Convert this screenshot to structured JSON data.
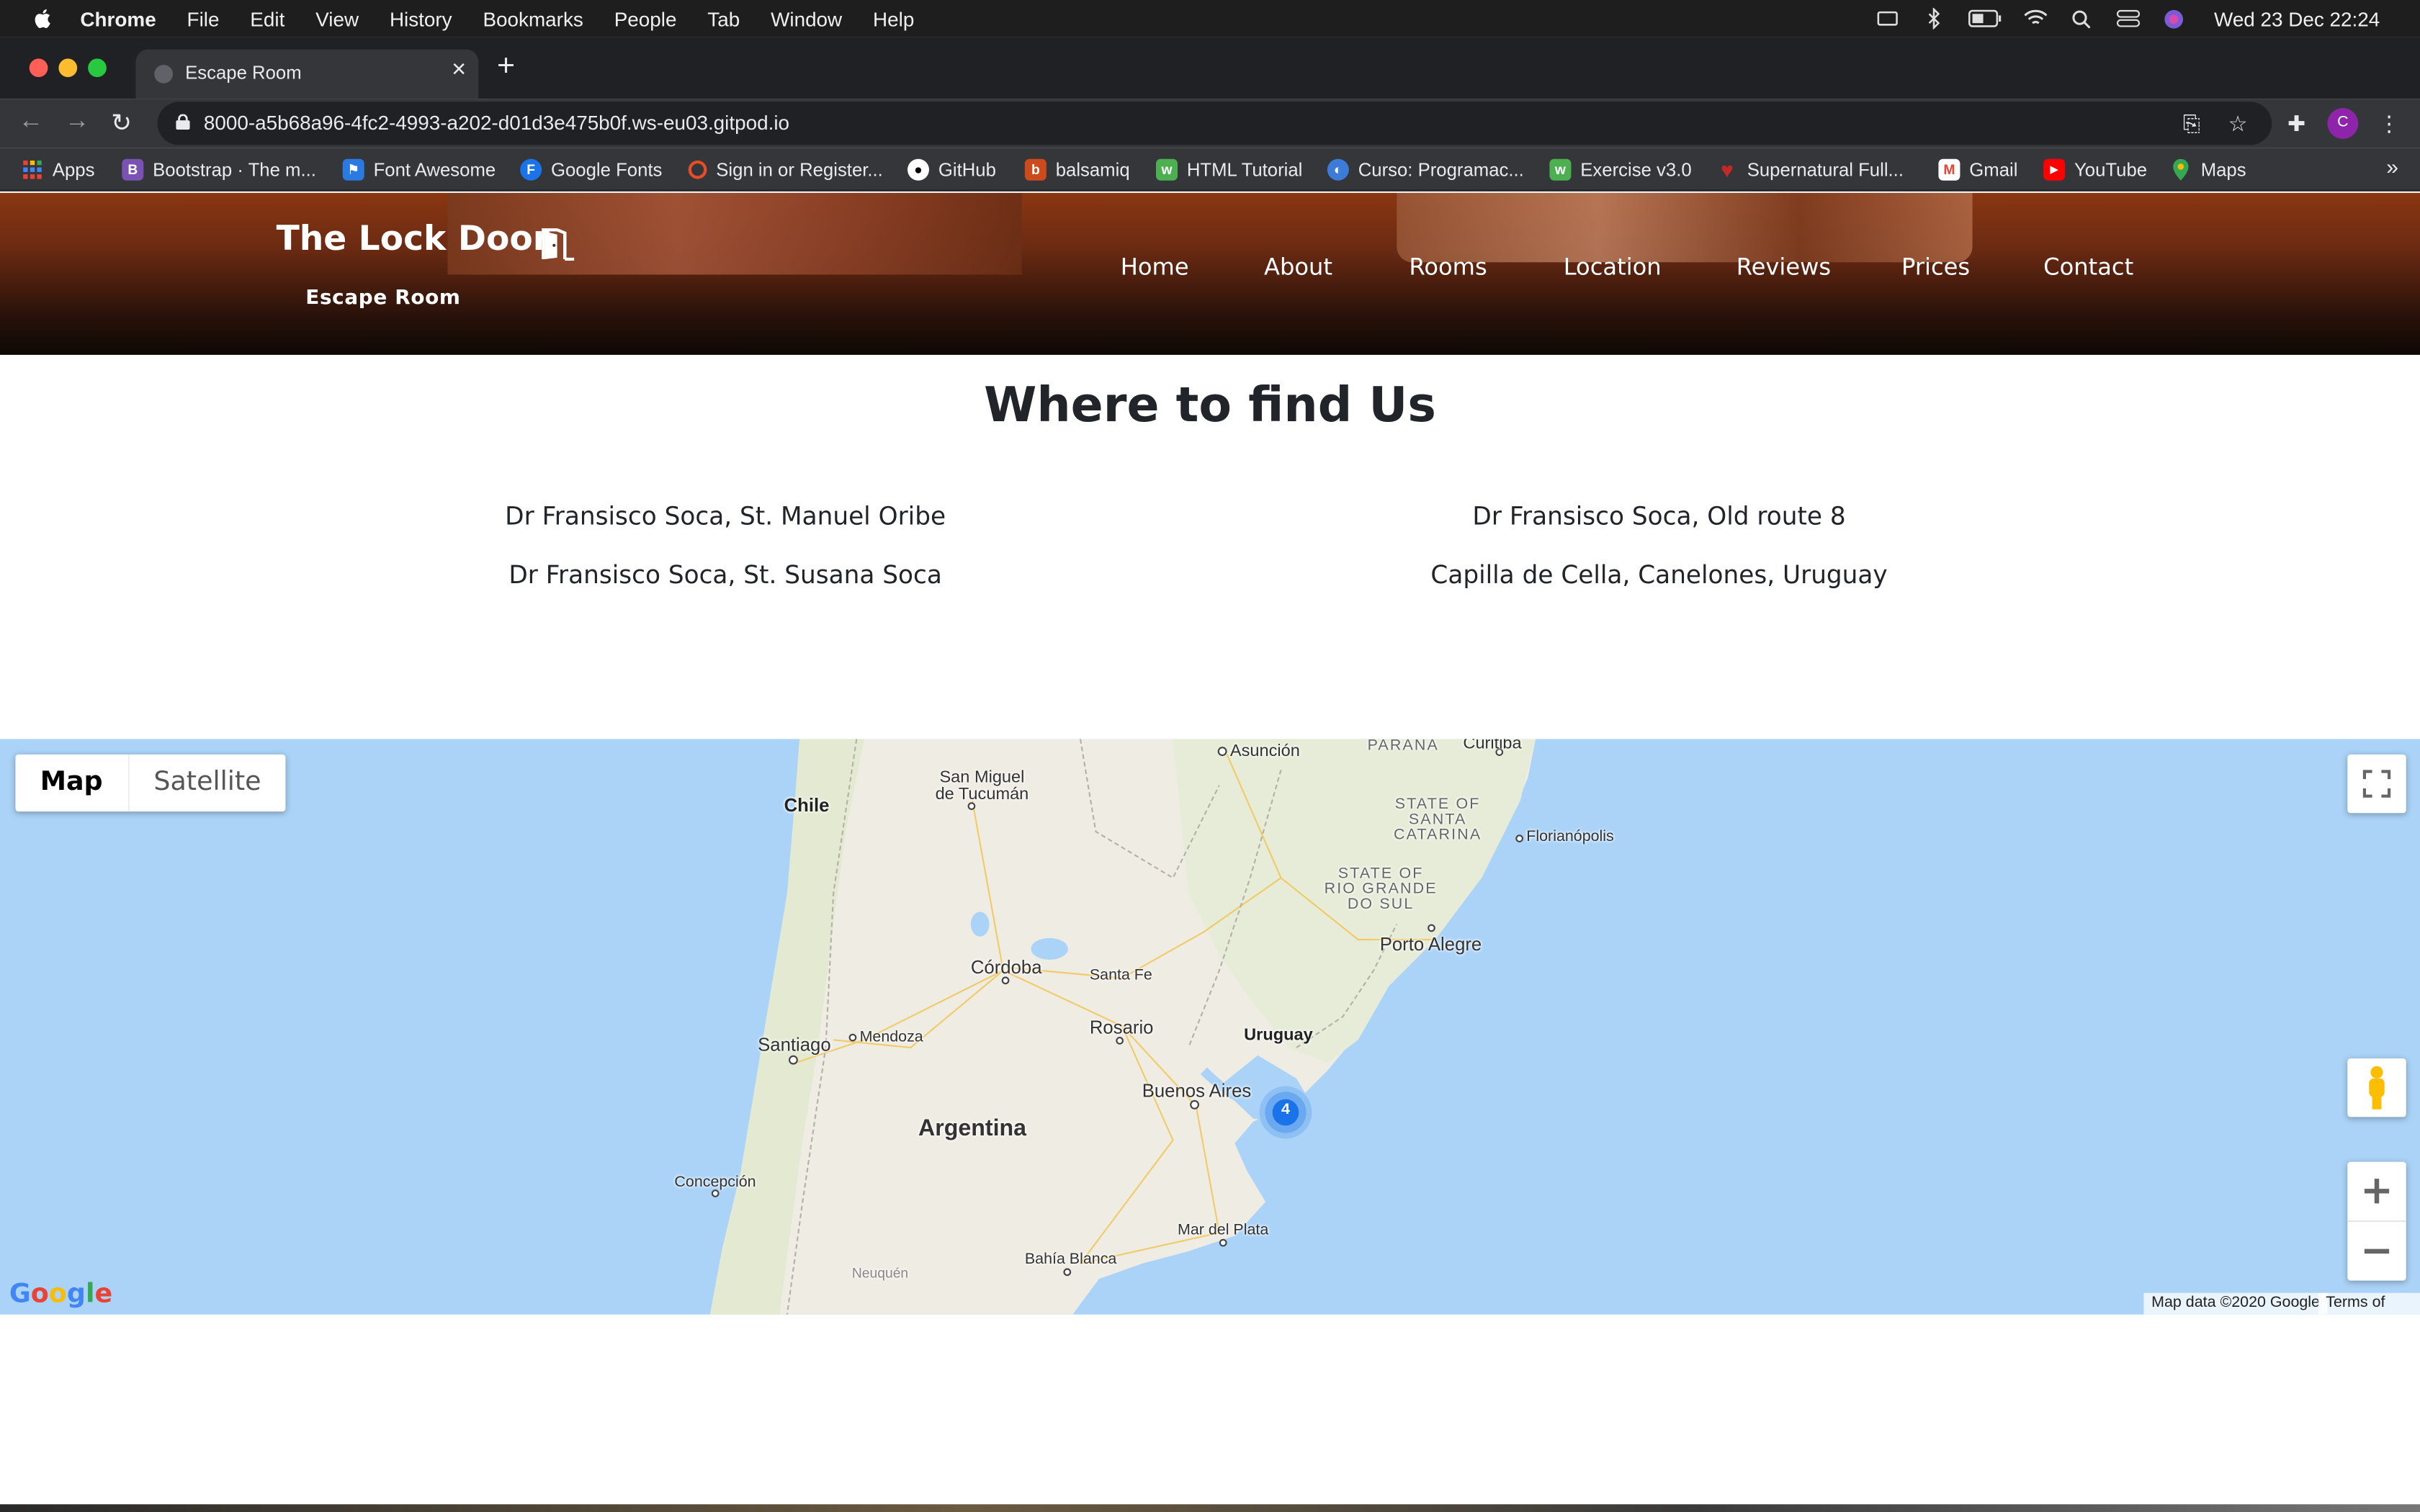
{
  "menubar": {
    "app": "Chrome",
    "items": [
      "File",
      "Edit",
      "View",
      "History",
      "Bookmarks",
      "People",
      "Tab",
      "Window",
      "Help"
    ],
    "clock": "Wed 23 Dec  22:24"
  },
  "browser": {
    "tab_title": "Escape Room",
    "url": "8000-a5b68a96-4fc2-4993-a202-d01d3e475b0f.ws-eu03.gitpod.io",
    "avatar": "C",
    "bookmarks": [
      {
        "label": "Apps",
        "icon": "apps-grid-icon",
        "color": "#4285f4"
      },
      {
        "label": "Bootstrap · The m...",
        "icon": "bootstrap-icon",
        "color": "#7952b3",
        "glyph": "B"
      },
      {
        "label": "Font Awesome",
        "icon": "flag-icon",
        "color": "#2a7ae2",
        "glyph": "⚑"
      },
      {
        "label": "Google Fonts",
        "icon": "google-fonts-icon",
        "color": "#1a73e8",
        "glyph": "F"
      },
      {
        "label": "Sign in or Register...",
        "icon": "ring-icon",
        "color": "#e44d26",
        "glyph": "○"
      },
      {
        "label": "GitHub",
        "icon": "github-icon",
        "color": "#ffffff",
        "glyph": "●"
      },
      {
        "label": "balsamiq",
        "icon": "balsamiq-icon",
        "color": "#cc4a1c",
        "glyph": "b"
      },
      {
        "label": "HTML Tutorial",
        "icon": "w3schools-icon",
        "color": "#4caf50",
        "glyph": "w"
      },
      {
        "label": "Curso: Programac...",
        "icon": "course-icon",
        "color": "#3d7bd9",
        "glyph": "◐"
      },
      {
        "label": "Exercise v3.0",
        "icon": "w3schools-icon",
        "color": "#4caf50",
        "glyph": "w"
      },
      {
        "label": "Supernatural Full...",
        "icon": "heart-icon",
        "color": "#c62828",
        "glyph": "♥"
      },
      {
        "label": "Gmail",
        "icon": "gmail-icon",
        "color": "#ea4335",
        "glyph": "M"
      },
      {
        "label": "YouTube",
        "icon": "youtube-icon",
        "color": "#ff0000",
        "glyph": "▶"
      },
      {
        "label": "Maps",
        "icon": "maps-pin-icon",
        "color": "#34a853",
        "glyph": "⬤"
      }
    ]
  },
  "site": {
    "brand": "The Lock Door",
    "tagline": "Escape Room",
    "nav": [
      "Home",
      "About",
      "Rooms",
      "Location",
      "Reviews",
      "Prices",
      "Contact"
    ],
    "section_title": "Where to find Us",
    "addresses": [
      "Dr Fransisco Soca, St. Manuel Oribe",
      "Dr Fransisco Soca, Old route 8",
      "Dr Fransisco Soca, St. Susana Soca",
      "Capilla de Cella, Canelones, Uruguay"
    ]
  },
  "map": {
    "type_buttons": [
      "Map",
      "Satellite"
    ],
    "cluster_count": "4",
    "labels": {
      "asuncion": "Asunción",
      "parana": "PARANÁ",
      "curitiba": "Curitiba",
      "chile": "Chile",
      "san_miguel": "San Miguel\nde Tucumán",
      "state_sc": "STATE OF\nSANTA\nCATARINA",
      "florianopolis": "Florianópolis",
      "state_rs": "STATE OF\nRIO GRANDE\nDO SUL",
      "porto_alegre": "Porto Alegre",
      "cordoba": "Córdoba",
      "santa_fe": "Santa Fe",
      "rosario": "Rosario",
      "uruguay": "Uruguay",
      "santiago": "Santiago",
      "mendoza": "Mendoza",
      "buenos_aires": "Buenos Aires",
      "argentina": "Argentina",
      "concepcion": "Concepción",
      "mar_del_plata": "Mar del Plata",
      "bahia_blanca": "Bahía Blanca",
      "neuquen": "Neuquén"
    },
    "attribution": "Map data ©2020 Google",
    "terms": "Terms of Use",
    "logo": "Google"
  }
}
